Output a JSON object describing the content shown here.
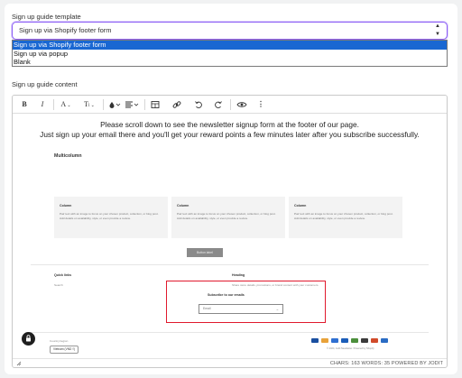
{
  "form": {
    "template_label": "Sign up guide template",
    "template_selected": "Sign up via Shopify footer form",
    "template_options": [
      "Sign up via Shopify footer form",
      "Sign up via popup",
      "Blank"
    ],
    "content_label": "Sign up guide content"
  },
  "toolbar": {
    "icons": [
      "bold-icon",
      "italic-icon",
      "font-icon",
      "font-size-icon",
      "text-color-icon",
      "align-icon",
      "table-icon",
      "link-icon",
      "undo-icon",
      "redo-icon",
      "preview-icon",
      "more-icon"
    ]
  },
  "editor": {
    "line1": "Please scroll down to see the newsletter signup form at the footer of our page.",
    "line2": "Just sign up your email there and you'll get your reward points a few minutes later after you subscribe successfully.",
    "preview": {
      "multicolumn_title": "Multicolumn",
      "columns": [
        {
          "heading": "Column",
          "text": "Pair text with an image to focus on your chosen product, collection, or blog post. Add details on availability, style, or even provide a review."
        },
        {
          "heading": "Column",
          "text": "Pair text with an image to focus on your chosen product, collection, or blog post. Add details on availability, style, or even provide a review."
        },
        {
          "heading": "Column",
          "text": "Pair text with an image to focus on your chosen product, collection, or blog post. Add details on availability, style, or even provide a review."
        }
      ],
      "button_label": "Button label",
      "quick_links_title": "Quick links",
      "quick_links_item": "Search",
      "heading_title": "Heading",
      "heading_text": "Share store details, promotions, or brand content with your customers.",
      "subscribe_title": "Subscribe to our emails",
      "email_placeholder": "Email",
      "email_arrow": "→",
      "country_label": "Country/region",
      "country_value": "Vietnam (VND ₫)",
      "copyright": "© 2024, Jodit Newsletter. Powered by Shopify"
    },
    "stats": "CHARS: 163   WORDS: 35   POWERED BY JODIT"
  },
  "colors": {
    "accent": "#8a5cf5",
    "highlight_box": "#e0192d",
    "selected_option": "#1967d2"
  }
}
